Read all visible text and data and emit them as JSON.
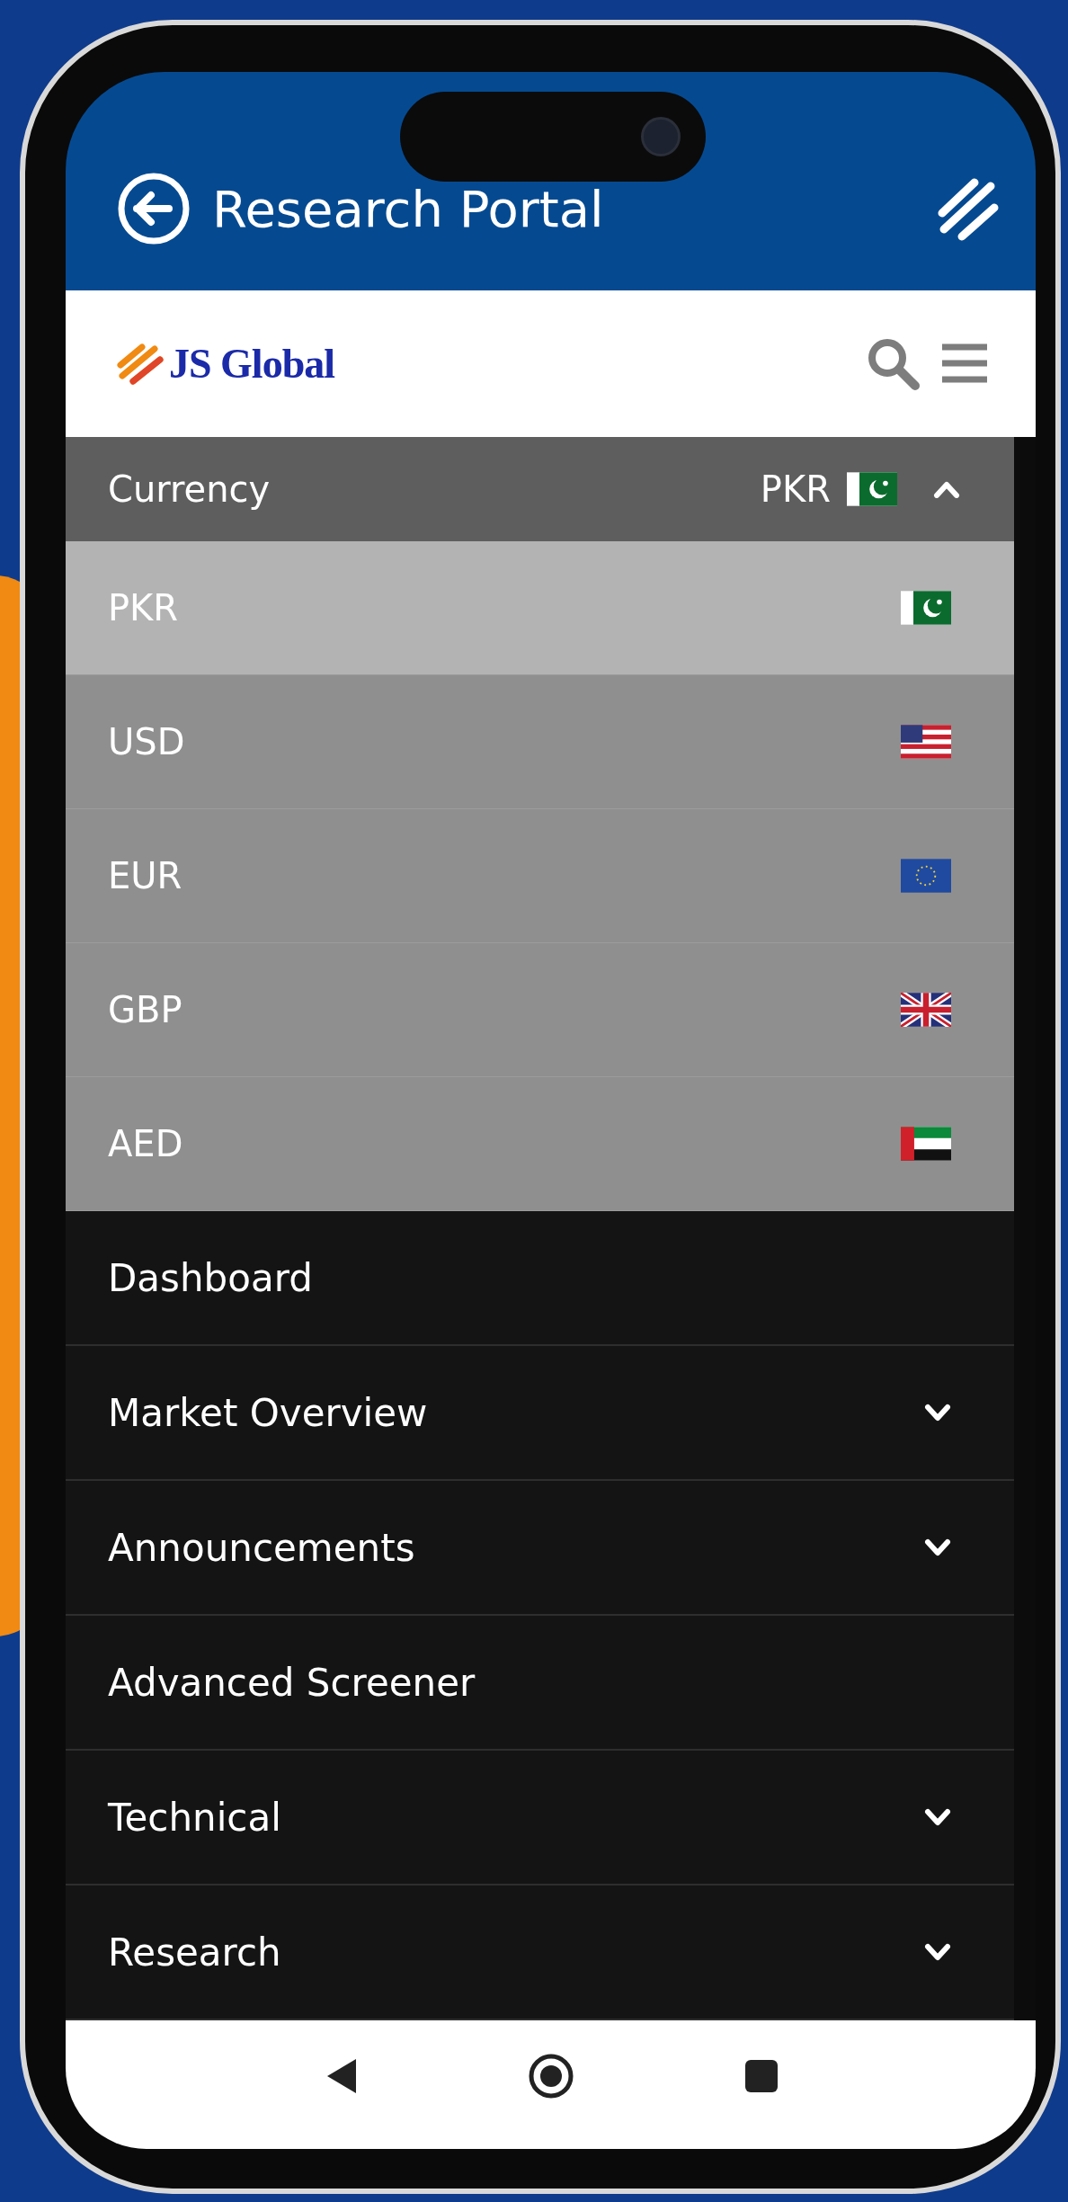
{
  "app_bar": {
    "title": "Research Portal"
  },
  "brand": {
    "name": "JS Global"
  },
  "currency": {
    "label": "Currency",
    "value": "PKR",
    "expanded": true,
    "options": [
      {
        "code": "PKR",
        "kind": "pakistan",
        "selected": true
      },
      {
        "code": "USD",
        "kind": "usa",
        "selected": false
      },
      {
        "code": "EUR",
        "kind": "eu",
        "selected": false
      },
      {
        "code": "GBP",
        "kind": "uk",
        "selected": false
      },
      {
        "code": "AED",
        "kind": "uae",
        "selected": false
      }
    ]
  },
  "menu": [
    {
      "label": "Dashboard",
      "kind": "link"
    },
    {
      "label": "Market Overview",
      "kind": "group",
      "expanded": false
    },
    {
      "label": "Announcements",
      "kind": "group",
      "expanded": false
    },
    {
      "label": "Advanced Screener",
      "kind": "link"
    },
    {
      "label": "Technical",
      "kind": "group",
      "expanded": false
    },
    {
      "label": "Research",
      "kind": "group",
      "expanded": false
    }
  ]
}
